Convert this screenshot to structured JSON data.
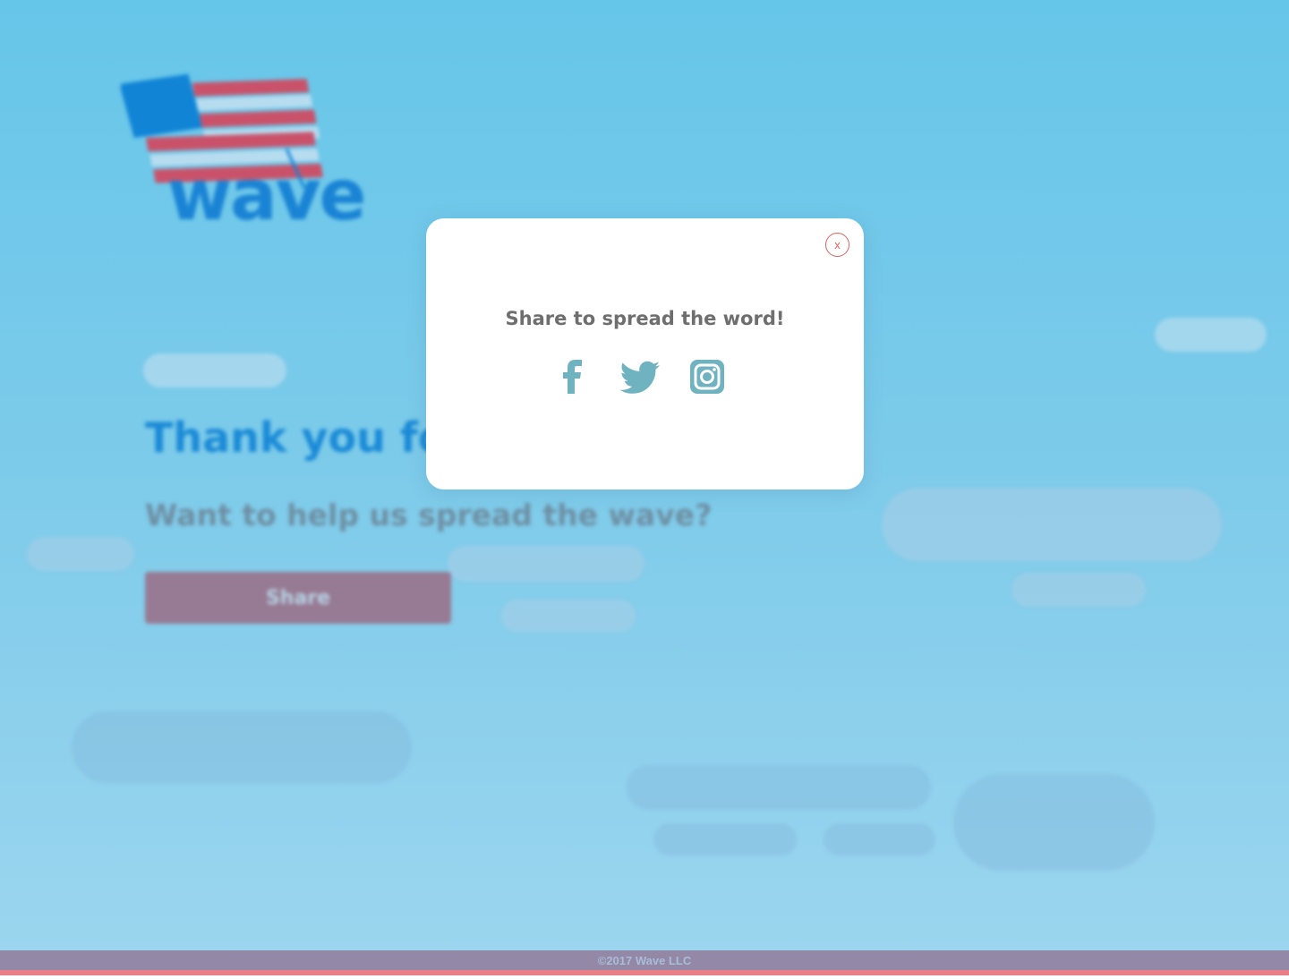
{
  "brand": {
    "logo_text": "wave",
    "flag_colors": {
      "canton": "#1184d6",
      "stripe_red": "#c9526a",
      "stripe_light": "#b8dcef"
    }
  },
  "hero": {
    "title": "Thank you for",
    "subtitle": "Want to help us spread the wave?",
    "share_button_label": "Share"
  },
  "footer": {
    "copyright": "©2017 Wave LLC"
  },
  "modal": {
    "close_label": "x",
    "title": "Share to spread the word!",
    "social": [
      {
        "name": "facebook",
        "icon": "facebook-icon"
      },
      {
        "name": "twitter",
        "icon": "twitter-icon"
      },
      {
        "name": "instagram",
        "icon": "instagram-icon"
      }
    ]
  },
  "colors": {
    "sky_top": "#66c6e9",
    "sky_bottom": "#9dd6ef",
    "accent_blue": "#1b8ad6",
    "share_button": "#977a93",
    "social_icon": "#6fb2c0",
    "close_red": "#e0605f",
    "footer_stripe": "#e97f86"
  }
}
